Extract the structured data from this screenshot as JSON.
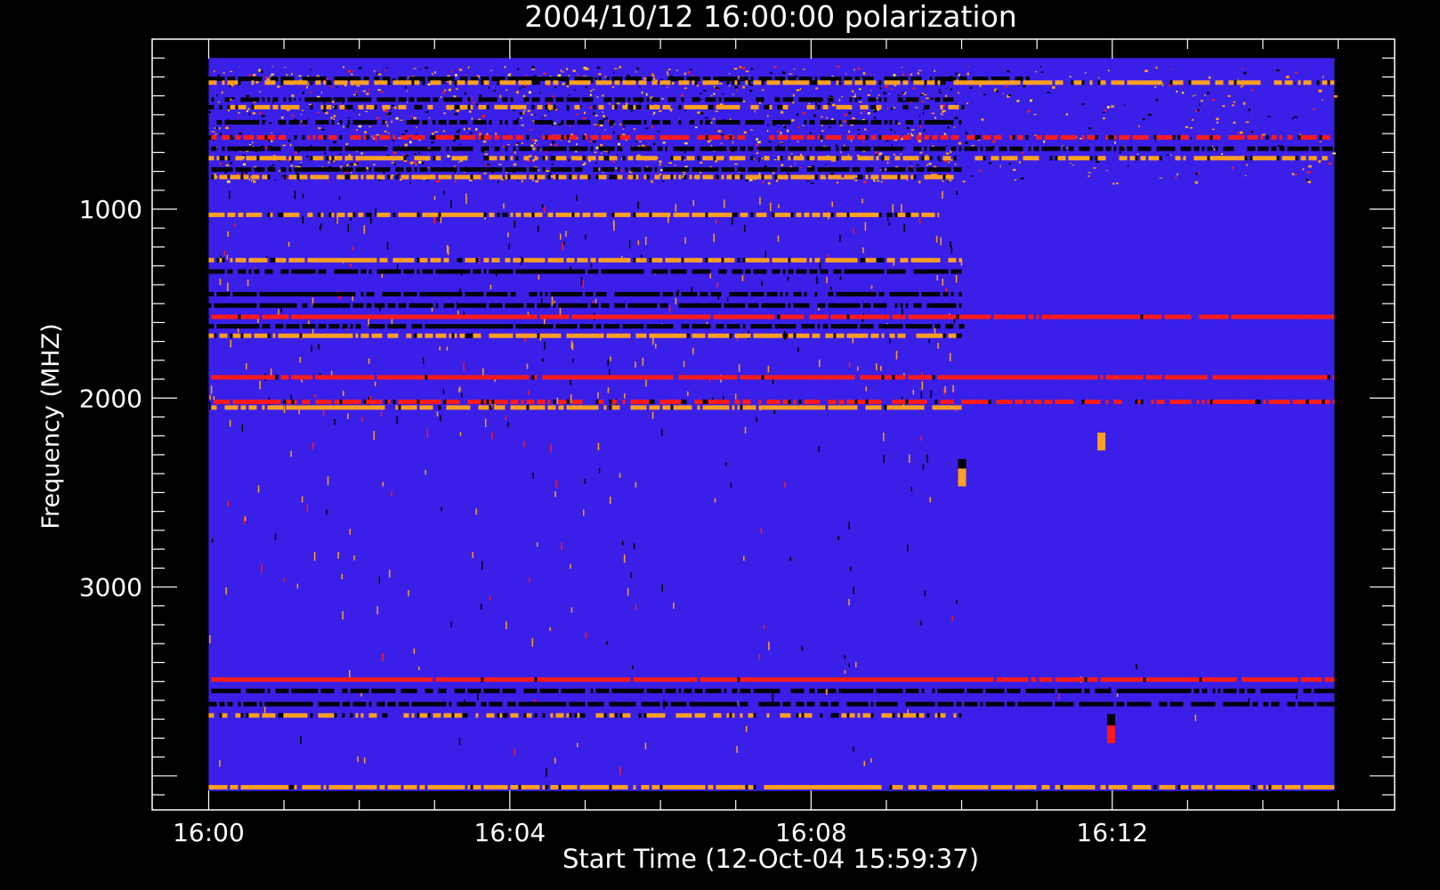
{
  "chart_data": {
    "type": "heatmap",
    "title": "2004/10/12 16:00:00 polarization",
    "xlabel": "Start Time (12-Oct-04 15:59:37)",
    "ylabel": "Frequency (MHZ)",
    "x_ticks": [
      "16:00",
      "16:04",
      "16:08",
      "16:12"
    ],
    "y_ticks": [
      "1000",
      "2000",
      "3000"
    ],
    "x_tick_minutes": [
      0,
      4,
      8,
      12
    ],
    "y_tick_values": [
      1000,
      2000,
      3000
    ],
    "xlim_minutes": [
      -0.75,
      15.75
    ],
    "data_xlim_minutes": [
      0,
      14.95
    ],
    "ylim": [
      100,
      4180
    ],
    "data_ylim": [
      200,
      4080
    ],
    "colors": {
      "background": "#3a1fe8",
      "red": "#ff1a1a",
      "orange": "#ffa020",
      "black": "#000000",
      "yellow": "#ffe040",
      "frame": "#ffffff"
    },
    "bands": [
      {
        "f": 310,
        "color": "black",
        "t0": 0,
        "t1": 10.9,
        "density": 0.5
      },
      {
        "f": 330,
        "color": "orange",
        "t0": 0,
        "t1": 14.95,
        "density": 0.5
      },
      {
        "f": 420,
        "color": "black",
        "t0": 0,
        "t1": 10,
        "density": 0.35
      },
      {
        "f": 460,
        "color": "orange",
        "t0": 0,
        "t1": 10,
        "density": 0.3
      },
      {
        "f": 540,
        "color": "black",
        "t0": 0,
        "t1": 10,
        "density": 0.3
      },
      {
        "f": 620,
        "color": "red",
        "t0": 0,
        "t1": 14.95,
        "density": 0.4
      },
      {
        "f": 680,
        "color": "black",
        "t0": 0,
        "t1": 14.95,
        "density": 0.45
      },
      {
        "f": 730,
        "color": "orange",
        "t0": 0,
        "t1": 14.95,
        "density": 0.4
      },
      {
        "f": 790,
        "color": "black",
        "t0": 0,
        "t1": 10,
        "density": 0.6
      },
      {
        "f": 830,
        "color": "orange",
        "t0": 0,
        "t1": 10,
        "density": 0.45
      },
      {
        "f": 1030,
        "color": "orange",
        "t0": 0,
        "t1": 9.7,
        "density": 0.5
      },
      {
        "f": 1270,
        "color": "orange",
        "t0": 0,
        "t1": 10,
        "density": 0.55
      },
      {
        "f": 1330,
        "color": "black",
        "t0": 0,
        "t1": 10,
        "density": 0.55
      },
      {
        "f": 1450,
        "color": "black",
        "t0": 0,
        "t1": 10,
        "density": 0.6
      },
      {
        "f": 1510,
        "color": "black",
        "t0": 0,
        "t1": 10,
        "density": 0.6
      },
      {
        "f": 1570,
        "color": "red",
        "t0": 0,
        "t1": 14.95,
        "density": 0.9
      },
      {
        "f": 1620,
        "color": "black",
        "t0": 0,
        "t1": 10,
        "density": 0.6
      },
      {
        "f": 1670,
        "color": "orange",
        "t0": 0,
        "t1": 10,
        "density": 0.55
      },
      {
        "f": 1890,
        "color": "red",
        "t0": 0,
        "t1": 14.95,
        "density": 0.85
      },
      {
        "f": 2020,
        "color": "red",
        "t0": 0,
        "t1": 14.95,
        "density": 0.5
      },
      {
        "f": 2050,
        "color": "orange",
        "t0": 0,
        "t1": 10,
        "density": 0.55
      },
      {
        "f": 3490,
        "color": "red",
        "t0": 0,
        "t1": 14.95,
        "density": 0.9
      },
      {
        "f": 3550,
        "color": "black",
        "t0": 0,
        "t1": 14.95,
        "density": 0.5
      },
      {
        "f": 3620,
        "color": "black",
        "t0": 0,
        "t1": 14.95,
        "density": 0.5
      },
      {
        "f": 3680,
        "color": "orange",
        "t0": 0,
        "t1": 10,
        "density": 0.35
      },
      {
        "f": 4060,
        "color": "orange",
        "t0": 0,
        "t1": 14.95,
        "density": 0.75
      }
    ],
    "features": [
      {
        "t": 10.0,
        "f": 2370,
        "color": "black"
      },
      {
        "t": 10.0,
        "f": 2420,
        "color": "orange"
      },
      {
        "t": 11.85,
        "f": 2230,
        "color": "orange"
      },
      {
        "t": 11.98,
        "f": 3720,
        "color": "black"
      },
      {
        "t": 11.98,
        "f": 3780,
        "color": "red"
      }
    ]
  }
}
